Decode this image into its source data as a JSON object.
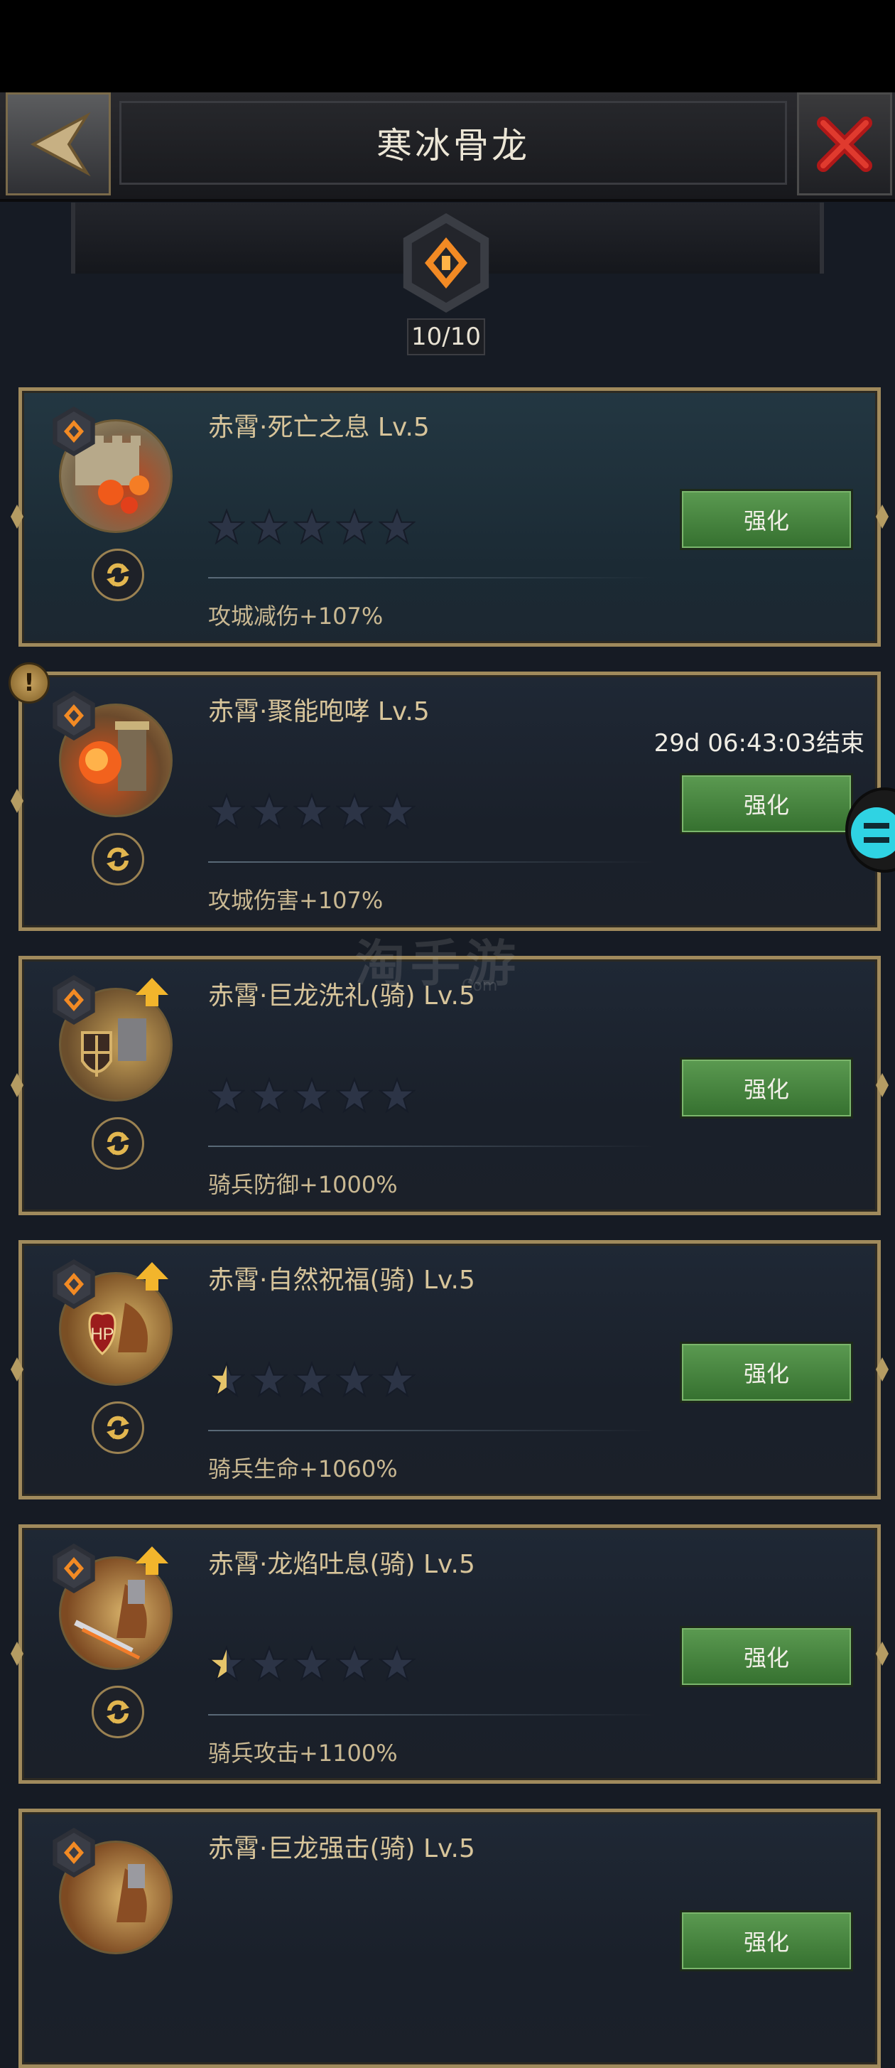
{
  "header": {
    "title": "寒冰骨龙"
  },
  "progress": {
    "text": "10/10",
    "current": 10,
    "total": 10
  },
  "colors": {
    "card_border": "#a08a5c",
    "enhance_green": "#4c8a44",
    "star_gold": "#e5c46a",
    "star_empty": "#2c3446"
  },
  "cards": [
    {
      "name": "赤霄·死亡之息 Lv.5",
      "effect": "攻城减伤+107%",
      "button": "强化",
      "stars_filled": 0,
      "portrait": "siege-wall-fire-icon"
    },
    {
      "name": "赤霄·聚能咆哮 Lv.5",
      "effect": "攻城伤害+107%",
      "button": "强化",
      "stars_filled": 0,
      "timer": "29d 06:43:03结束",
      "portrait": "siege-tower-fire-icon"
    },
    {
      "name": "赤霄·巨龙洗礼(骑) Lv.5",
      "effect": "骑兵防御+1000%",
      "button": "强化",
      "stars_filled": 0,
      "portrait": "cavalry-shield-icon"
    },
    {
      "name": "赤霄·自然祝福(骑) Lv.5",
      "effect": "骑兵生命+1060%",
      "button": "强化",
      "stars_filled": 0.5,
      "portrait": "cavalry-hp-icon"
    },
    {
      "name": "赤霄·龙焰吐息(骑) Lv.5",
      "effect": "骑兵攻击+1100%",
      "button": "强化",
      "stars_filled": 0.5,
      "portrait": "cavalry-sword-icon"
    },
    {
      "name": "赤霄·巨龙强击(骑) Lv.5",
      "effect": "",
      "button": "强化",
      "stars_filled": 0,
      "portrait": "cavalry-strike-icon"
    }
  ],
  "watermark": {
    "text": "淘手游",
    "sub": "Com"
  }
}
